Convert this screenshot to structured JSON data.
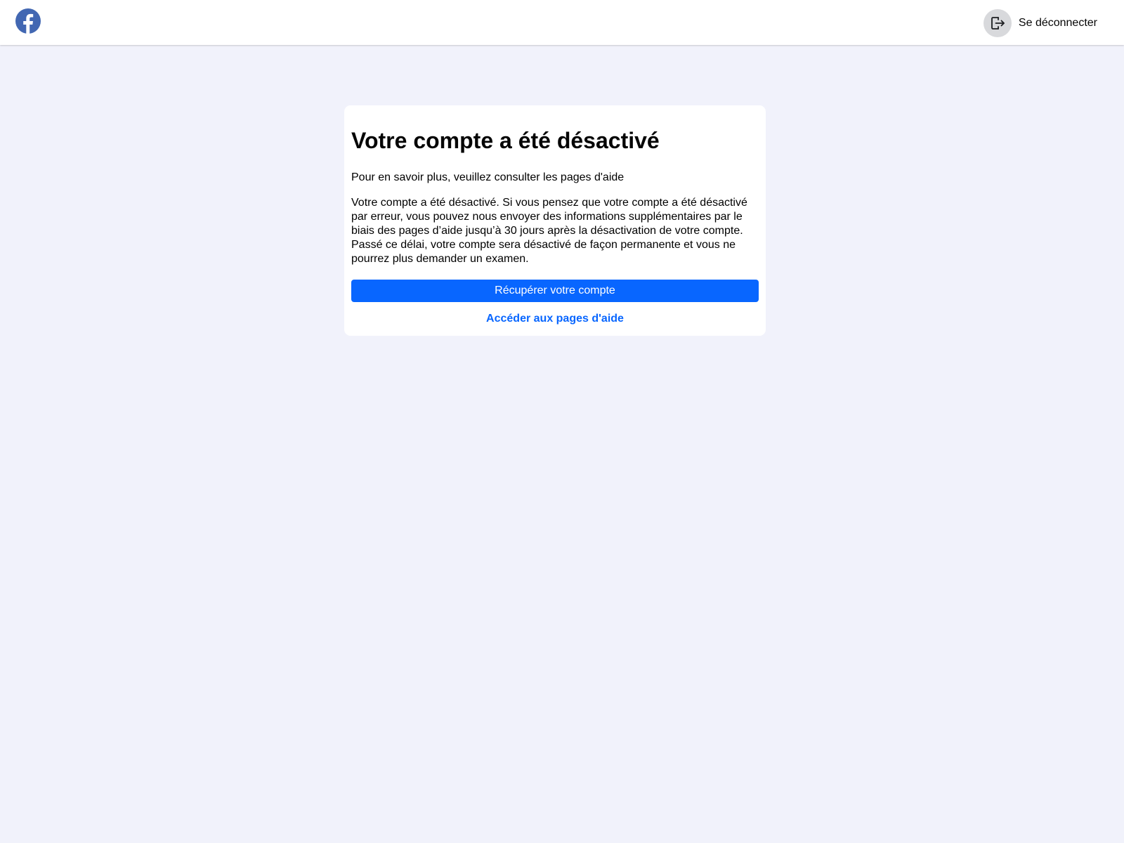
{
  "header": {
    "logo_icon": "facebook-logo-icon",
    "logout_icon": "logout-arrow-icon",
    "logout_label": "Se déconnecter"
  },
  "card": {
    "title": "Votre compte a été désactivé",
    "intro": "Pour en savoir plus, veuillez consulter les pages d'aide",
    "body": "Votre compte a été désactivé. Si vous pensez que votre compte a été désactivé par erreur, vous pouvez nous envoyer des informations supplémentaires par le biais des pages d’aide jusqu’à 30 jours après la désactivation de votre compte. Passé ce délai, votre compte sera désactivé de façon permanente et vous ne pourrez plus demander un examen.",
    "primary_button_label": "Récupérer votre compte",
    "help_link_label": "Accéder aux pages d'aide"
  },
  "colors": {
    "background": "#f1f2fb",
    "brand_blue": "#0866ff",
    "logo_blue": "#4267b2"
  }
}
